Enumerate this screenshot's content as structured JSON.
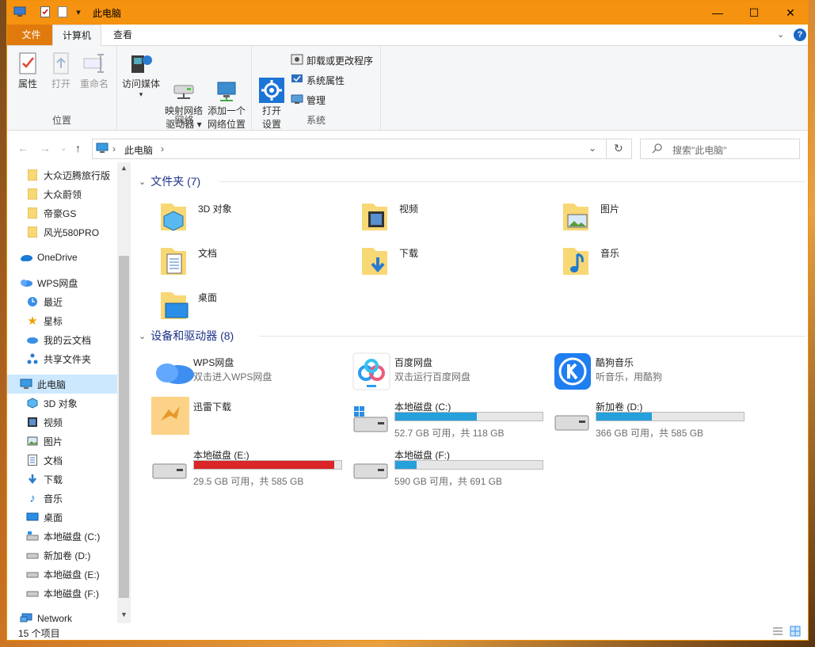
{
  "window": {
    "title": "此电脑"
  },
  "title_buttons": {
    "minimize": "—",
    "maximize": "☐",
    "close": "✕"
  },
  "tabs": [
    "文件",
    "计算机",
    "查看"
  ],
  "ribbon": {
    "groups": [
      {
        "label": "位置",
        "buttons": [
          "属性",
          "打开",
          "重命名"
        ]
      },
      {
        "label": "网络",
        "buttons": [
          "访问媒体",
          "映射网络\n驱动器 ▾",
          "添加一个\n网络位置"
        ]
      },
      {
        "label": "系统",
        "buttons": [
          "打开\n设置"
        ],
        "small": [
          "卸载或更改程序",
          "系统属性",
          "管理"
        ]
      }
    ]
  },
  "address": {
    "path": "此电脑",
    "search_placeholder": "搜索\"此电脑\""
  },
  "nav": {
    "items": [
      {
        "label": "大众迈腾旅行版",
        "icon": "folder-icon"
      },
      {
        "label": "大众蔚领",
        "icon": "folder-icon"
      },
      {
        "label": "帝豪GS",
        "icon": "folder-icon"
      },
      {
        "label": "风光580PRO",
        "icon": "folder-icon"
      },
      {
        "label": "OneDrive",
        "icon": "onedrive-icon"
      },
      {
        "label": "WPS网盘",
        "icon": "wps-cloud-icon"
      },
      {
        "label": "最近",
        "icon": "clock-icon"
      },
      {
        "label": "星标",
        "icon": "star-icon"
      },
      {
        "label": "我的云文档",
        "icon": "cloud-doc-icon"
      },
      {
        "label": "共享文件夹",
        "icon": "share-icon"
      },
      {
        "label": "此电脑",
        "icon": "computer-icon"
      },
      {
        "label": "3D 对象",
        "icon": "cube-icon"
      },
      {
        "label": "视频",
        "icon": "video-icon"
      },
      {
        "label": "图片",
        "icon": "picture-icon"
      },
      {
        "label": "文档",
        "icon": "document-icon"
      },
      {
        "label": "下载",
        "icon": "download-icon"
      },
      {
        "label": "音乐",
        "icon": "music-icon"
      },
      {
        "label": "桌面",
        "icon": "desktop-icon"
      },
      {
        "label": "本地磁盘 (C:)",
        "icon": "drive-c-icon"
      },
      {
        "label": "新加卷 (D:)",
        "icon": "drive-icon"
      },
      {
        "label": "本地磁盘 (E:)",
        "icon": "drive-icon"
      },
      {
        "label": "本地磁盘 (F:)",
        "icon": "drive-icon"
      },
      {
        "label": "Network",
        "icon": "network-icon"
      }
    ]
  },
  "folders_section": {
    "title": "文件夹 (7)",
    "items": [
      "3D 对象",
      "视频",
      "图片",
      "文档",
      "下载",
      "音乐",
      "桌面"
    ]
  },
  "devices_section": {
    "title": "设备和驱动器 (8)",
    "apps": [
      {
        "name": "WPS网盘",
        "desc": "双击进入WPS网盘"
      },
      {
        "name": "百度网盘",
        "desc": "双击运行百度网盘"
      },
      {
        "name": "酷狗音乐",
        "desc": "听音乐，用酷狗"
      },
      {
        "name": "迅雷下载",
        "desc": ""
      }
    ],
    "drives": [
      {
        "name": "本地磁盘 (C:)",
        "size": "52.7 GB 可用，共 118 GB",
        "used_fraction": 0.553,
        "color": "#26a0da"
      },
      {
        "name": "新加卷 (D:)",
        "size": "366 GB 可用，共 585 GB",
        "used_fraction": 0.374,
        "color": "#26a0da"
      },
      {
        "name": "本地磁盘 (E:)",
        "size": "29.5 GB 可用，共 585 GB",
        "used_fraction": 0.95,
        "color": "#da2626"
      },
      {
        "name": "本地磁盘 (F:)",
        "size": "590 GB 可用，共 691 GB",
        "used_fraction": 0.146,
        "color": "#26a0da"
      }
    ]
  },
  "status": {
    "count": "15 个项目"
  }
}
